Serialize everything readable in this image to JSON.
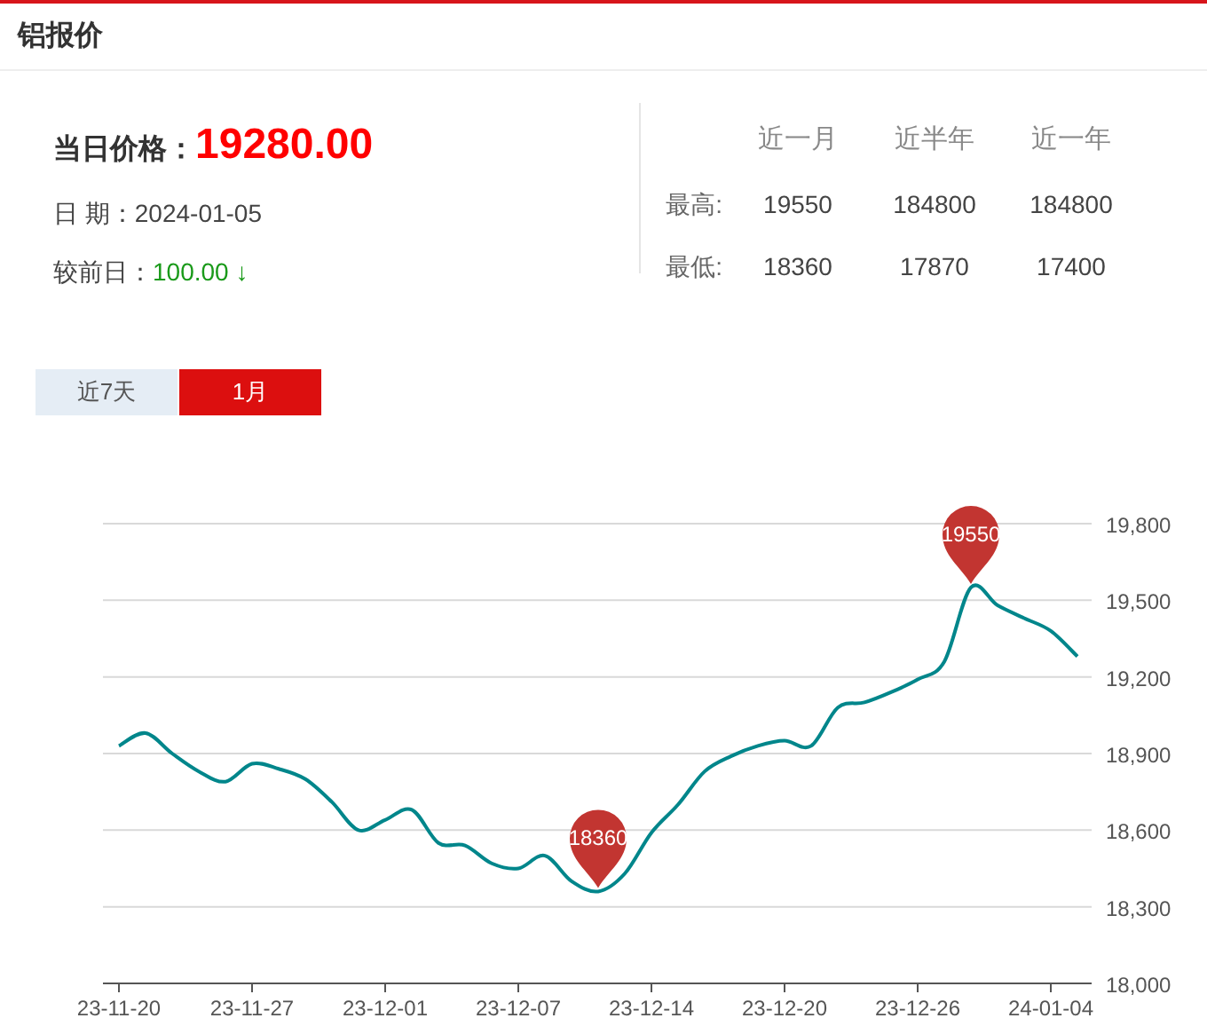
{
  "title": "铝报价",
  "price": {
    "label": "当日价格：",
    "value": "19280.00"
  },
  "date": {
    "label": "日 期：",
    "value": "2024-01-05"
  },
  "change": {
    "label": "较前日：",
    "value": "100.00 ↓"
  },
  "stats": {
    "columns": [
      "近一月",
      "近半年",
      "近一年"
    ],
    "rows": [
      {
        "label": "最高:",
        "values": [
          "19550",
          "184800",
          "184800"
        ]
      },
      {
        "label": "最低:",
        "values": [
          "18360",
          "17870",
          "17400"
        ]
      }
    ]
  },
  "tabs": [
    {
      "label": "近7天",
      "selected": false
    },
    {
      "label": "1月",
      "selected": true
    }
  ],
  "chart_data": {
    "type": "line",
    "categories": [
      "23-11-20",
      null,
      null,
      null,
      null,
      "23-11-27",
      null,
      null,
      null,
      null,
      "23-12-01",
      null,
      null,
      null,
      null,
      "23-12-07",
      null,
      null,
      null,
      null,
      "23-12-14",
      null,
      null,
      null,
      null,
      "23-12-20",
      null,
      null,
      null,
      null,
      "23-12-26",
      null,
      null,
      null,
      null,
      "24-01-04",
      null
    ],
    "yticks": [
      {
        "value": 18000,
        "label": "18,000"
      },
      {
        "value": 18300,
        "label": "18,300"
      },
      {
        "value": 18600,
        "label": "18,600"
      },
      {
        "value": 18900,
        "label": "18,900"
      },
      {
        "value": 19200,
        "label": "19,200"
      },
      {
        "value": 19500,
        "label": "19,500"
      },
      {
        "value": 19800,
        "label": "19,800"
      }
    ],
    "ylim": [
      18000,
      19800
    ],
    "series": [
      {
        "color": "#00868b",
        "values": [
          18930,
          18980,
          18900,
          18830,
          18790,
          18860,
          18840,
          18800,
          18710,
          18600,
          18640,
          18680,
          18550,
          18540,
          18470,
          18450,
          18500,
          18400,
          18360,
          18430,
          18590,
          18700,
          18830,
          18890,
          18930,
          18950,
          18930,
          19080,
          19100,
          19140,
          19190,
          19260,
          19550,
          19480,
          19430,
          19380,
          19280
        ]
      }
    ],
    "grid": true,
    "annotations": [
      {
        "y": 18360,
        "text": "18360"
      },
      {
        "y": 19550,
        "text": "19550"
      }
    ]
  }
}
